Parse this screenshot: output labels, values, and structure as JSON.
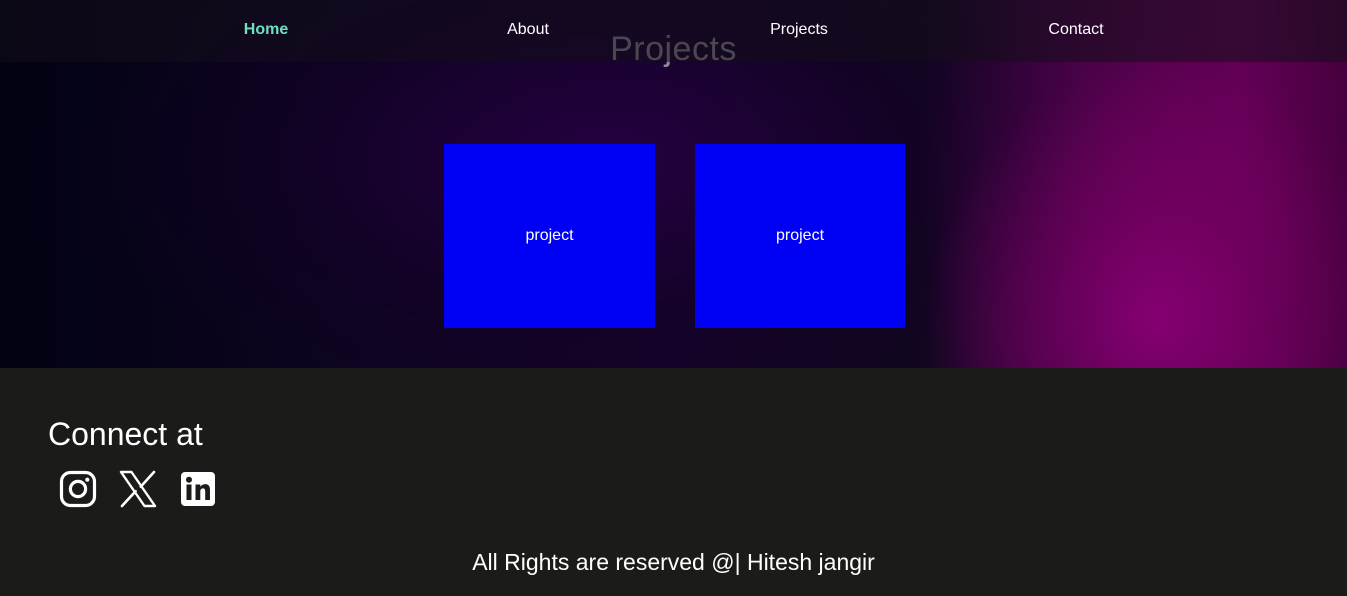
{
  "nav": {
    "items": [
      {
        "label": "Home",
        "active": true
      },
      {
        "label": "About"
      },
      {
        "label": "Projects"
      },
      {
        "label": "Contact"
      }
    ],
    "active_color": "#6ee0c0"
  },
  "projects": {
    "title": "Projects",
    "cards": [
      {
        "label": "project"
      },
      {
        "label": "project"
      }
    ],
    "card_color": "#0000f4"
  },
  "footer": {
    "connect_heading": "Connect at",
    "social": [
      {
        "icon": "instagram-icon"
      },
      {
        "icon": "x-icon"
      },
      {
        "icon": "linkedin-icon"
      }
    ],
    "copyright": "All Rights are reserved @| Hitesh jangir",
    "background": "#1b1b19"
  }
}
